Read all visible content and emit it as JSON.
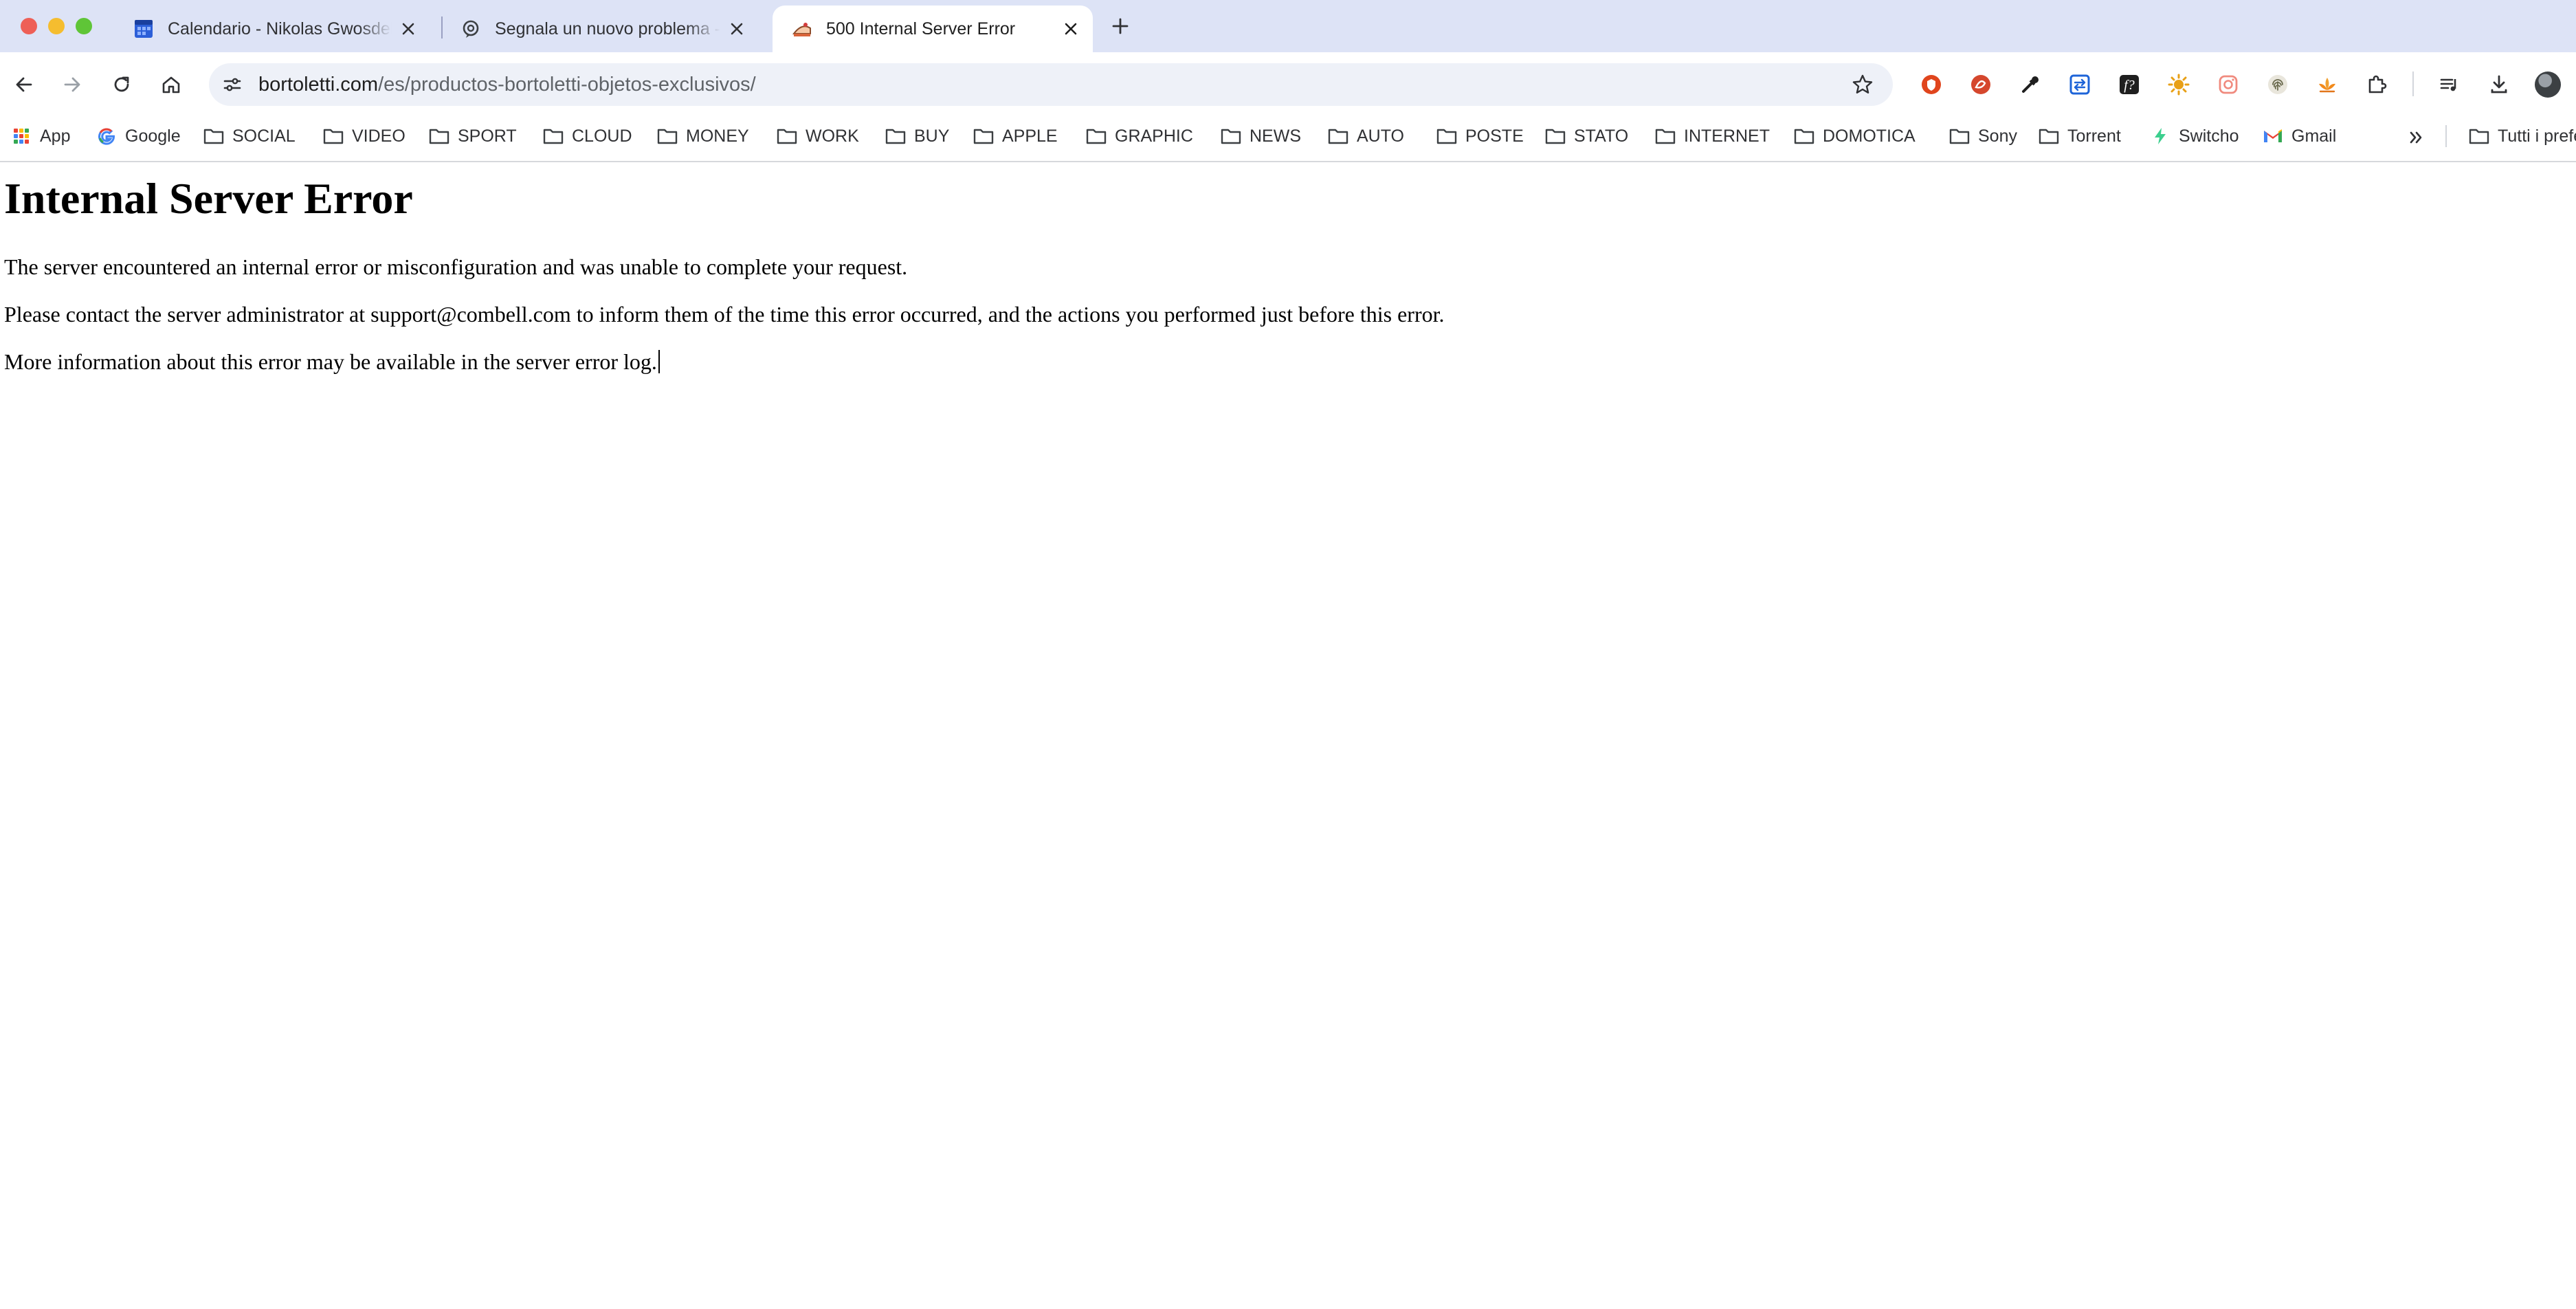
{
  "browser": {
    "tabs": [
      {
        "title": "Calendario - Nikolas Gwosdek",
        "favicon": "calendar-icon",
        "active": false
      },
      {
        "title": "Segnala un nuovo problema - ",
        "favicon": "support-icon",
        "active": false
      },
      {
        "title": "500 Internal Server Error",
        "favicon": "cake-icon",
        "active": true
      }
    ],
    "new_tab_icon": "plus-icon",
    "toolbar": {
      "back_icon": "arrow-left-icon",
      "forward_icon": "arrow-right-icon",
      "reload_icon": "reload-icon",
      "home_icon": "home-icon",
      "site_info_icon": "tune-icon",
      "bookmark_star_icon": "star-icon"
    },
    "address_bar": {
      "host": "bortoletti.com",
      "path": "/es/productos-bortoletti-objetos-exclusivos/"
    },
    "extensions": [
      "brave-shield-icon",
      "pdf-icon",
      "eyedropper-icon",
      "translate-icon",
      "font-icon",
      "sun-icon",
      "instagram-icon",
      "fingerprint-icon",
      "lotus-icon",
      "puzzle-icon"
    ],
    "right_toolbar": [
      "media-queue-icon",
      "download-icon",
      "avatar"
    ],
    "bookmarks": [
      {
        "label": "App",
        "icon": "apps-grid-icon"
      },
      {
        "label": "Google",
        "icon": "google-icon"
      },
      {
        "label": "SOCIAL",
        "icon": "folder-icon"
      },
      {
        "label": "VIDEO",
        "icon": "folder-icon"
      },
      {
        "label": "SPORT",
        "icon": "folder-icon"
      },
      {
        "label": "CLOUD",
        "icon": "folder-icon"
      },
      {
        "label": "MONEY",
        "icon": "folder-icon"
      },
      {
        "label": "WORK",
        "icon": "folder-icon"
      },
      {
        "label": "BUY",
        "icon": "folder-icon"
      },
      {
        "label": "APPLE",
        "icon": "folder-icon"
      },
      {
        "label": "GRAPHIC",
        "icon": "folder-icon"
      },
      {
        "label": "NEWS",
        "icon": "folder-icon"
      },
      {
        "label": "AUTO",
        "icon": "folder-icon"
      },
      {
        "label": "POSTE",
        "icon": "folder-icon"
      },
      {
        "label": "STATO",
        "icon": "folder-icon"
      },
      {
        "label": "INTERNET",
        "icon": "folder-icon"
      },
      {
        "label": "DOMOTICA",
        "icon": "folder-icon"
      },
      {
        "label": "Sony",
        "icon": "folder-icon"
      },
      {
        "label": "Torrent",
        "icon": "folder-icon"
      },
      {
        "label": "Switcho",
        "icon": "switcho-icon"
      },
      {
        "label": "Gmail",
        "icon": "gmail-icon"
      }
    ],
    "more_bookmarks_icon": "chevron-double-right-icon",
    "all_bookmarks": {
      "label": "Tutti i preferiti",
      "icon": "folder-icon"
    }
  },
  "page": {
    "heading": "Internal Server Error",
    "paragraphs": [
      "The server encountered an internal error or misconfiguration and was unable to complete your request.",
      "Please contact the server administrator at support@combell.com to inform them of the time this error occurred, and the actions you performed just before this error.",
      "More information about this error may be available in the server error log."
    ]
  },
  "colors": {
    "tab_strip_bg": "#dde3f6",
    "omnibox_bg": "#eef1f8",
    "close_red": "#ee5f57",
    "minimize_yellow": "#f5bd2f",
    "zoom_green": "#5fc537"
  }
}
